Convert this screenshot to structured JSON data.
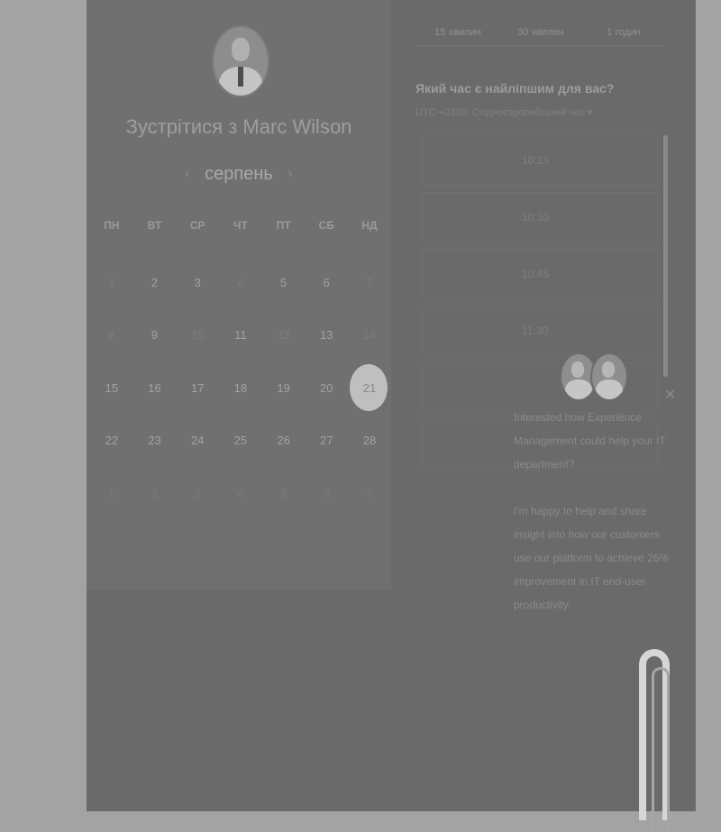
{
  "host": {
    "title": "Зустрітися з Marc Wilson"
  },
  "calendar": {
    "month": "серпень",
    "prev_icon": "chevron-left-icon",
    "next_icon": "chevron-right-icon",
    "weekdays": [
      "ПН",
      "ВТ",
      "СР",
      "ЧТ",
      "ПТ",
      "СБ",
      "НД"
    ],
    "days": [
      {
        "d": "1",
        "state": "disabled"
      },
      {
        "d": "2",
        "state": "available"
      },
      {
        "d": "3",
        "state": "available"
      },
      {
        "d": "4",
        "state": "disabled"
      },
      {
        "d": "5",
        "state": "available"
      },
      {
        "d": "6",
        "state": "available"
      },
      {
        "d": "7",
        "state": "disabled"
      },
      {
        "d": "8",
        "state": "disabled"
      },
      {
        "d": "9",
        "state": "available"
      },
      {
        "d": "10",
        "state": "disabled"
      },
      {
        "d": "11",
        "state": "available"
      },
      {
        "d": "12",
        "state": "disabled"
      },
      {
        "d": "13",
        "state": "available"
      },
      {
        "d": "14",
        "state": "disabled"
      },
      {
        "d": "15",
        "state": "available"
      },
      {
        "d": "16",
        "state": "available"
      },
      {
        "d": "17",
        "state": "available"
      },
      {
        "d": "18",
        "state": "available"
      },
      {
        "d": "19",
        "state": "available"
      },
      {
        "d": "20",
        "state": "available"
      },
      {
        "d": "21",
        "state": "selected"
      },
      {
        "d": "22",
        "state": "available"
      },
      {
        "d": "23",
        "state": "available"
      },
      {
        "d": "24",
        "state": "available"
      },
      {
        "d": "25",
        "state": "available"
      },
      {
        "d": "26",
        "state": "available"
      },
      {
        "d": "27",
        "state": "available"
      },
      {
        "d": "28",
        "state": "available"
      },
      {
        "d": "1",
        "state": "other"
      },
      {
        "d": "2",
        "state": "other"
      },
      {
        "d": "3",
        "state": "other"
      },
      {
        "d": "4",
        "state": "other"
      },
      {
        "d": "5",
        "state": "other"
      },
      {
        "d": "6",
        "state": "other"
      },
      {
        "d": "7",
        "state": "other"
      }
    ]
  },
  "durations": [
    "15 хвилин",
    "30 хвилин",
    "1 годин"
  ],
  "time_picker": {
    "question": "Який час є найліпшим для вас?",
    "timezone": "UTC +03:00 Східноєвропейський час ▾",
    "slots": [
      "10:15",
      "10:30",
      "10:45",
      "11:30",
      "",
      ""
    ]
  },
  "chat": {
    "close_icon": "close-icon",
    "message_1": "Interested how Experience Management could help your IT department?",
    "message_2": "I'm happy to help and share insight into how our customers use our platform to achieve 26% improvement in IT end-user productivity."
  },
  "colors": {
    "overlay_bg": "#a3a3a3",
    "page_bg": "#6a6a6a",
    "selected_day": "#bfbfbf"
  }
}
